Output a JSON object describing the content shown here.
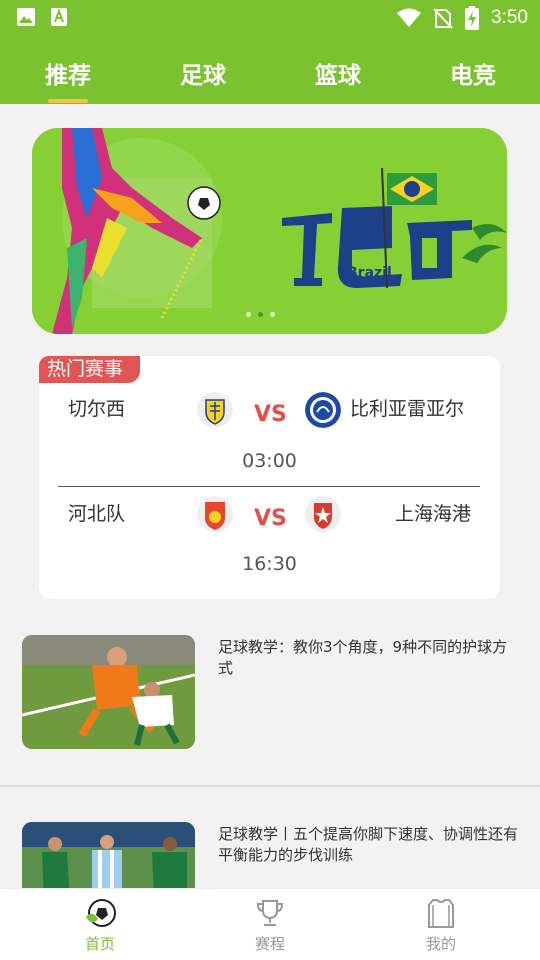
{
  "status_bar": {
    "time": "3:50"
  },
  "top_tabs": [
    {
      "label": "推荐",
      "active": true
    },
    {
      "label": "足球",
      "active": false
    },
    {
      "label": "篮球",
      "active": false
    },
    {
      "label": "电竞",
      "active": false
    }
  ],
  "banner": {
    "text_en": "Brazil",
    "slide_count": 3,
    "active_slide": 1
  },
  "hot_matches": {
    "badge": "热门赛事",
    "matches": [
      {
        "home": "切尔西",
        "away": "比利亚雷亚尔",
        "vs": "VS",
        "time": "03:00"
      },
      {
        "home": "河北队",
        "away": "上海海港",
        "vs": "VS",
        "time": "16:30"
      }
    ]
  },
  "articles": [
    {
      "title": "足球教学：教你3个角度，9种不同的护球方式"
    },
    {
      "title": "足球教学丨五个提高你脚下速度、协调性还有平衡能力的步伐训练"
    }
  ],
  "bottom_nav": [
    {
      "label": "首页",
      "icon": "soccer-ball-icon",
      "active": true
    },
    {
      "label": "赛程",
      "icon": "trophy-icon",
      "active": false
    },
    {
      "label": "我的",
      "icon": "jersey-icon",
      "active": false
    }
  ],
  "colors": {
    "brand_green": "#7cc12f",
    "vs_red": "#e84c4c",
    "badge_red": "#e25555",
    "tab_underline": "#f6c445"
  }
}
